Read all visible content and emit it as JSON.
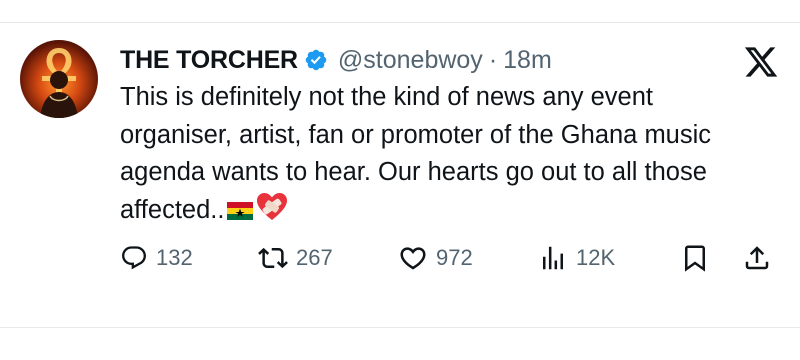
{
  "tweet": {
    "display_name": "THE TORCHER",
    "handle": "@stonebwoy",
    "separator": "·",
    "time": "18m",
    "text": "This is definitely not the kind of news any event organiser, artist, fan or promoter of the Ghana music agenda wants to hear. Our hearts go out to all those affected..",
    "emojis": [
      "ghana-flag",
      "mending-heart"
    ]
  },
  "actions": {
    "replies": "132",
    "reposts": "267",
    "likes": "972",
    "views": "12K"
  },
  "colors": {
    "verified": "#1d9bf0",
    "secondary_text": "#536471",
    "primary_text": "#0f1419"
  },
  "icons": [
    "verified-badge-icon",
    "x-logo-icon",
    "reply-icon",
    "repost-icon",
    "like-icon",
    "views-icon",
    "bookmark-icon",
    "share-icon"
  ]
}
